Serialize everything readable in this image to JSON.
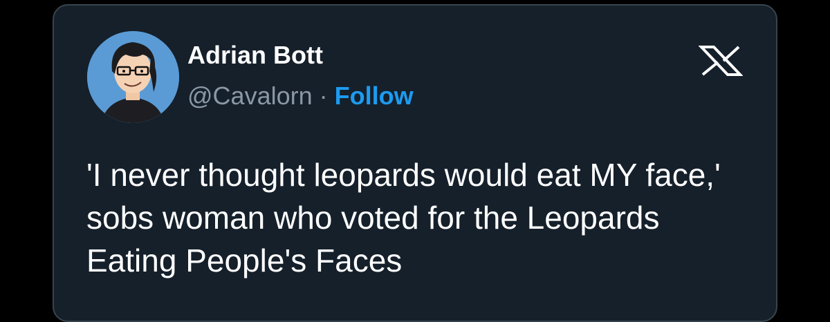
{
  "author": {
    "name": "Adrian Bott",
    "handle": "@Cavalorn",
    "separator": "·",
    "follow_label": "Follow"
  },
  "icons": {
    "brand": "x-logo-icon",
    "avatar": "cartoon-avatar"
  },
  "tweet": {
    "text": "'I never thought leopards would eat MY face,' sobs woman who voted for the Leopards Eating People's Faces"
  },
  "colors": {
    "background": "#000000",
    "card": "#15202b",
    "text": "#ffffff",
    "muted": "#8b98a5",
    "link": "#1d9bf0",
    "avatar_bg": "#5b9bd5"
  }
}
